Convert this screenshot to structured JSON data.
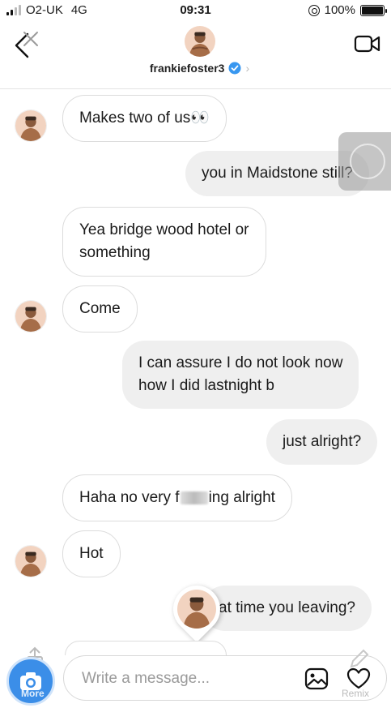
{
  "status_bar": {
    "carrier": "O2-UK",
    "network": "4G",
    "time": "09:31",
    "battery": "100%",
    "battery_level": 1.0
  },
  "header": {
    "username": "frankiefoster3",
    "back_icon": "chevron-left-icon",
    "video_icon": "video-camera-icon",
    "verified_icon": "verified-badge-icon",
    "verified_color": "#3897f0"
  },
  "messages": [
    {
      "from": "them",
      "text": "Makes two of us👀"
    },
    {
      "from": "me",
      "text": "you in Maidstone still?"
    },
    {
      "from": "them",
      "lines": [
        "Yea bridge wood hotel or",
        "something"
      ]
    },
    {
      "from": "them",
      "text": "Come"
    },
    {
      "from": "me",
      "lines": [
        "I can assure I do not look now",
        "how I did lastnight b"
      ]
    },
    {
      "from": "me",
      "text": "just alright?"
    },
    {
      "from": "them",
      "text_before": "Haha no very f",
      "text_after": "ing alright"
    },
    {
      "from": "them",
      "text": "Hot"
    },
    {
      "from": "me",
      "text": "at time you leaving?"
    }
  ],
  "composer": {
    "placeholder": "Write a message...",
    "camera_icon": "camera-icon",
    "gallery_icon": "image-gallery-icon",
    "heart_icon": "heart-icon",
    "accent": "#3b8ee8"
  },
  "watermark": {
    "left_label": "More",
    "right_label": "Remix"
  },
  "colors": {
    "incoming_bubble_border": "#dcdcdc",
    "outgoing_bubble_bg": "#efefef"
  }
}
